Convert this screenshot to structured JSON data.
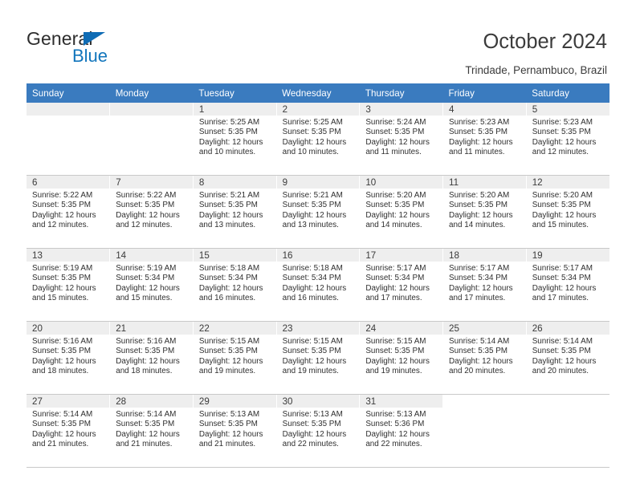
{
  "brand": {
    "name_top": "General",
    "name_bottom": "Blue",
    "triangle_color": "#0f6cb5",
    "text_color": "#2d2d2d",
    "blue_color": "#1175bc"
  },
  "header": {
    "title": "October 2024",
    "subtitle": "Trindade, Pernambuco, Brazil"
  },
  "calendar": {
    "header_bg": "#3a7bbf",
    "daynum_bg": "#eeeeee",
    "weekday_labels": [
      "Sunday",
      "Monday",
      "Tuesday",
      "Wednesday",
      "Thursday",
      "Friday",
      "Saturday"
    ],
    "weeks": [
      [
        {
          "day": "",
          "empty": true
        },
        {
          "day": "",
          "empty": true
        },
        {
          "day": "1",
          "sunrise": "Sunrise: 5:25 AM",
          "sunset": "Sunset: 5:35 PM",
          "daylight_1": "Daylight: 12 hours",
          "daylight_2": "and 10 minutes."
        },
        {
          "day": "2",
          "sunrise": "Sunrise: 5:25 AM",
          "sunset": "Sunset: 5:35 PM",
          "daylight_1": "Daylight: 12 hours",
          "daylight_2": "and 10 minutes."
        },
        {
          "day": "3",
          "sunrise": "Sunrise: 5:24 AM",
          "sunset": "Sunset: 5:35 PM",
          "daylight_1": "Daylight: 12 hours",
          "daylight_2": "and 11 minutes."
        },
        {
          "day": "4",
          "sunrise": "Sunrise: 5:23 AM",
          "sunset": "Sunset: 5:35 PM",
          "daylight_1": "Daylight: 12 hours",
          "daylight_2": "and 11 minutes."
        },
        {
          "day": "5",
          "sunrise": "Sunrise: 5:23 AM",
          "sunset": "Sunset: 5:35 PM",
          "daylight_1": "Daylight: 12 hours",
          "daylight_2": "and 12 minutes."
        }
      ],
      [
        {
          "day": "6",
          "sunrise": "Sunrise: 5:22 AM",
          "sunset": "Sunset: 5:35 PM",
          "daylight_1": "Daylight: 12 hours",
          "daylight_2": "and 12 minutes."
        },
        {
          "day": "7",
          "sunrise": "Sunrise: 5:22 AM",
          "sunset": "Sunset: 5:35 PM",
          "daylight_1": "Daylight: 12 hours",
          "daylight_2": "and 12 minutes."
        },
        {
          "day": "8",
          "sunrise": "Sunrise: 5:21 AM",
          "sunset": "Sunset: 5:35 PM",
          "daylight_1": "Daylight: 12 hours",
          "daylight_2": "and 13 minutes."
        },
        {
          "day": "9",
          "sunrise": "Sunrise: 5:21 AM",
          "sunset": "Sunset: 5:35 PM",
          "daylight_1": "Daylight: 12 hours",
          "daylight_2": "and 13 minutes."
        },
        {
          "day": "10",
          "sunrise": "Sunrise: 5:20 AM",
          "sunset": "Sunset: 5:35 PM",
          "daylight_1": "Daylight: 12 hours",
          "daylight_2": "and 14 minutes."
        },
        {
          "day": "11",
          "sunrise": "Sunrise: 5:20 AM",
          "sunset": "Sunset: 5:35 PM",
          "daylight_1": "Daylight: 12 hours",
          "daylight_2": "and 14 minutes."
        },
        {
          "day": "12",
          "sunrise": "Sunrise: 5:20 AM",
          "sunset": "Sunset: 5:35 PM",
          "daylight_1": "Daylight: 12 hours",
          "daylight_2": "and 15 minutes."
        }
      ],
      [
        {
          "day": "13",
          "sunrise": "Sunrise: 5:19 AM",
          "sunset": "Sunset: 5:35 PM",
          "daylight_1": "Daylight: 12 hours",
          "daylight_2": "and 15 minutes."
        },
        {
          "day": "14",
          "sunrise": "Sunrise: 5:19 AM",
          "sunset": "Sunset: 5:34 PM",
          "daylight_1": "Daylight: 12 hours",
          "daylight_2": "and 15 minutes."
        },
        {
          "day": "15",
          "sunrise": "Sunrise: 5:18 AM",
          "sunset": "Sunset: 5:34 PM",
          "daylight_1": "Daylight: 12 hours",
          "daylight_2": "and 16 minutes."
        },
        {
          "day": "16",
          "sunrise": "Sunrise: 5:18 AM",
          "sunset": "Sunset: 5:34 PM",
          "daylight_1": "Daylight: 12 hours",
          "daylight_2": "and 16 minutes."
        },
        {
          "day": "17",
          "sunrise": "Sunrise: 5:17 AM",
          "sunset": "Sunset: 5:34 PM",
          "daylight_1": "Daylight: 12 hours",
          "daylight_2": "and 17 minutes."
        },
        {
          "day": "18",
          "sunrise": "Sunrise: 5:17 AM",
          "sunset": "Sunset: 5:34 PM",
          "daylight_1": "Daylight: 12 hours",
          "daylight_2": "and 17 minutes."
        },
        {
          "day": "19",
          "sunrise": "Sunrise: 5:17 AM",
          "sunset": "Sunset: 5:34 PM",
          "daylight_1": "Daylight: 12 hours",
          "daylight_2": "and 17 minutes."
        }
      ],
      [
        {
          "day": "20",
          "sunrise": "Sunrise: 5:16 AM",
          "sunset": "Sunset: 5:35 PM",
          "daylight_1": "Daylight: 12 hours",
          "daylight_2": "and 18 minutes."
        },
        {
          "day": "21",
          "sunrise": "Sunrise: 5:16 AM",
          "sunset": "Sunset: 5:35 PM",
          "daylight_1": "Daylight: 12 hours",
          "daylight_2": "and 18 minutes."
        },
        {
          "day": "22",
          "sunrise": "Sunrise: 5:15 AM",
          "sunset": "Sunset: 5:35 PM",
          "daylight_1": "Daylight: 12 hours",
          "daylight_2": "and 19 minutes."
        },
        {
          "day": "23",
          "sunrise": "Sunrise: 5:15 AM",
          "sunset": "Sunset: 5:35 PM",
          "daylight_1": "Daylight: 12 hours",
          "daylight_2": "and 19 minutes."
        },
        {
          "day": "24",
          "sunrise": "Sunrise: 5:15 AM",
          "sunset": "Sunset: 5:35 PM",
          "daylight_1": "Daylight: 12 hours",
          "daylight_2": "and 19 minutes."
        },
        {
          "day": "25",
          "sunrise": "Sunrise: 5:14 AM",
          "sunset": "Sunset: 5:35 PM",
          "daylight_1": "Daylight: 12 hours",
          "daylight_2": "and 20 minutes."
        },
        {
          "day": "26",
          "sunrise": "Sunrise: 5:14 AM",
          "sunset": "Sunset: 5:35 PM",
          "daylight_1": "Daylight: 12 hours",
          "daylight_2": "and 20 minutes."
        }
      ],
      [
        {
          "day": "27",
          "sunrise": "Sunrise: 5:14 AM",
          "sunset": "Sunset: 5:35 PM",
          "daylight_1": "Daylight: 12 hours",
          "daylight_2": "and 21 minutes."
        },
        {
          "day": "28",
          "sunrise": "Sunrise: 5:14 AM",
          "sunset": "Sunset: 5:35 PM",
          "daylight_1": "Daylight: 12 hours",
          "daylight_2": "and 21 minutes."
        },
        {
          "day": "29",
          "sunrise": "Sunrise: 5:13 AM",
          "sunset": "Sunset: 5:35 PM",
          "daylight_1": "Daylight: 12 hours",
          "daylight_2": "and 21 minutes."
        },
        {
          "day": "30",
          "sunrise": "Sunrise: 5:13 AM",
          "sunset": "Sunset: 5:35 PM",
          "daylight_1": "Daylight: 12 hours",
          "daylight_2": "and 22 minutes."
        },
        {
          "day": "31",
          "sunrise": "Sunrise: 5:13 AM",
          "sunset": "Sunset: 5:36 PM",
          "daylight_1": "Daylight: 12 hours",
          "daylight_2": "and 22 minutes."
        },
        {
          "day": "",
          "blank": true
        },
        {
          "day": "",
          "blank": true
        }
      ]
    ]
  }
}
